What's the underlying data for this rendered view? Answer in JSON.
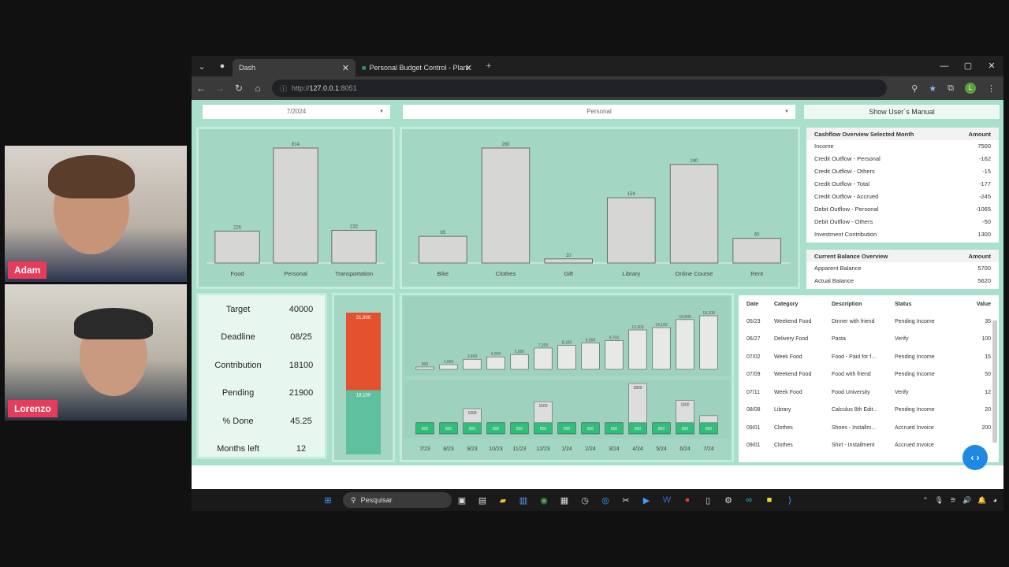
{
  "participants": [
    {
      "name": "Adam"
    },
    {
      "name": "Lorenzo"
    }
  ],
  "browser": {
    "tabs": [
      {
        "title": "Dash",
        "active": true
      },
      {
        "title": "Personal Budget Control - Plani"
      }
    ],
    "url_protocol": "http://",
    "url_host": "127.0.0.1",
    "url_port": ":8051"
  },
  "controls": {
    "month": "7/2024",
    "category": "Personal",
    "manual_button": "Show User´s Manual"
  },
  "chart_data": [
    {
      "type": "bar",
      "categories": [
        "Food",
        "Personal",
        "Transportation"
      ],
      "values": [
        226,
        814,
        232
      ],
      "ylim": [
        0,
        814
      ]
    },
    {
      "type": "bar",
      "categories": [
        "Bike",
        "Clothes",
        "Gift",
        "Library",
        "Online Course",
        "Rent"
      ],
      "values": [
        65,
        280,
        10,
        159,
        240,
        60
      ],
      "ylim": [
        0,
        280
      ]
    },
    {
      "type": "bar",
      "stacked": true,
      "categories": [
        ""
      ],
      "series": [
        {
          "name": "",
          "values": [
            18100
          ],
          "color": "#5fc0a0"
        },
        {
          "name": "",
          "values": [
            21900
          ],
          "color": "#e4512f"
        }
      ],
      "labels": [
        "21,900",
        "18,100"
      ]
    },
    {
      "type": "bar",
      "categories": [
        "7/23",
        "8/23",
        "9/23",
        "10/23",
        "11/23",
        "12/23",
        "1/24",
        "2/24",
        "3/24",
        "4/24",
        "5/24",
        "6/24",
        "7/24"
      ],
      "values": [
        800,
        1600,
        3400,
        4200,
        5000,
        7200,
        8100,
        8900,
        9700,
        13300,
        14100,
        16800,
        18100
      ],
      "labels": [
        "800",
        "1,600",
        "3,400",
        "4,200",
        "5,000",
        "7,200",
        "8,100",
        "8,900",
        "9,700",
        "13,300",
        "14,100",
        "16,800",
        "18,100"
      ]
    },
    {
      "type": "bar",
      "stacked": true,
      "categories": [
        "7/23",
        "8/23",
        "9/23",
        "10/23",
        "11/23",
        "12/23",
        "1/24",
        "2/24",
        "3/24",
        "4/24",
        "5/24",
        "6/24",
        "7/24"
      ],
      "series": [
        {
          "name": "",
          "values": [
            800,
            800,
            800,
            800,
            800,
            800,
            800,
            800,
            800,
            800,
            800,
            800,
            800
          ],
          "color": "#2fbf7a"
        },
        {
          "name": "",
          "values": [
            0,
            0,
            1000,
            0,
            0,
            1500,
            0,
            0,
            0,
            2800,
            0,
            1600,
            500
          ],
          "color": "#ddd"
        }
      ],
      "ymax": 3600
    }
  ],
  "cashflow": {
    "header": [
      "Cashflow Overview Selected Month",
      "Amount"
    ],
    "rows": [
      [
        "Income",
        "7500"
      ],
      [
        "Credit Outflow - Personal",
        "-162"
      ],
      [
        "Credit Outflow - Others",
        "-15"
      ],
      [
        "Credit Outflow - Total",
        "-177"
      ],
      [
        "Credit Outflow - Accrued",
        "-245"
      ],
      [
        "Debit Outflow - Personal",
        "-1065"
      ],
      [
        "Debit Outflow - Others",
        "-50"
      ],
      [
        "Investment Contribution",
        "1300"
      ]
    ]
  },
  "balance": {
    "header": [
      "Current Balance Overview",
      "Amount"
    ],
    "rows": [
      [
        "Apparent Balance",
        "5700"
      ],
      [
        "Actual Balance",
        "5620"
      ]
    ]
  },
  "goal": {
    "rows": [
      [
        "Target",
        "40000"
      ],
      [
        "Deadline",
        "08/25"
      ],
      [
        "Contribution",
        "18100"
      ],
      [
        "Pending",
        "21900"
      ],
      [
        "% Done",
        "45.25"
      ],
      [
        "Months left",
        "12"
      ]
    ]
  },
  "transactions": {
    "columns": [
      "Date",
      "Category",
      "Description",
      "Status",
      "Value"
    ],
    "rows": [
      [
        "05/23",
        "Weekend Food",
        "Dinner with friend",
        "Pending Income",
        "35"
      ],
      [
        "06/27",
        "Delivery Food",
        "Pasta",
        "Verify",
        "100"
      ],
      [
        "07/02",
        "Week Food",
        "Food - Paid for f...",
        "Pending Income",
        "15"
      ],
      [
        "07/09",
        "Weekend Food",
        "Food with friend",
        "Pending Income",
        "50"
      ],
      [
        "07/11",
        "Week Food",
        "Food University",
        "Verify",
        "12"
      ],
      [
        "08/08",
        "Library",
        "Calculus 8th Edit...",
        "Pending Income",
        "20"
      ],
      [
        "09/01",
        "Clothes",
        "Shoes - Installm...",
        "Accrued Invoice",
        "200"
      ],
      [
        "09/01",
        "Clothes",
        "Shirt - Installment",
        "Accrued Invoice",
        ""
      ]
    ]
  },
  "taskbar": {
    "search": "Pesquisar"
  }
}
